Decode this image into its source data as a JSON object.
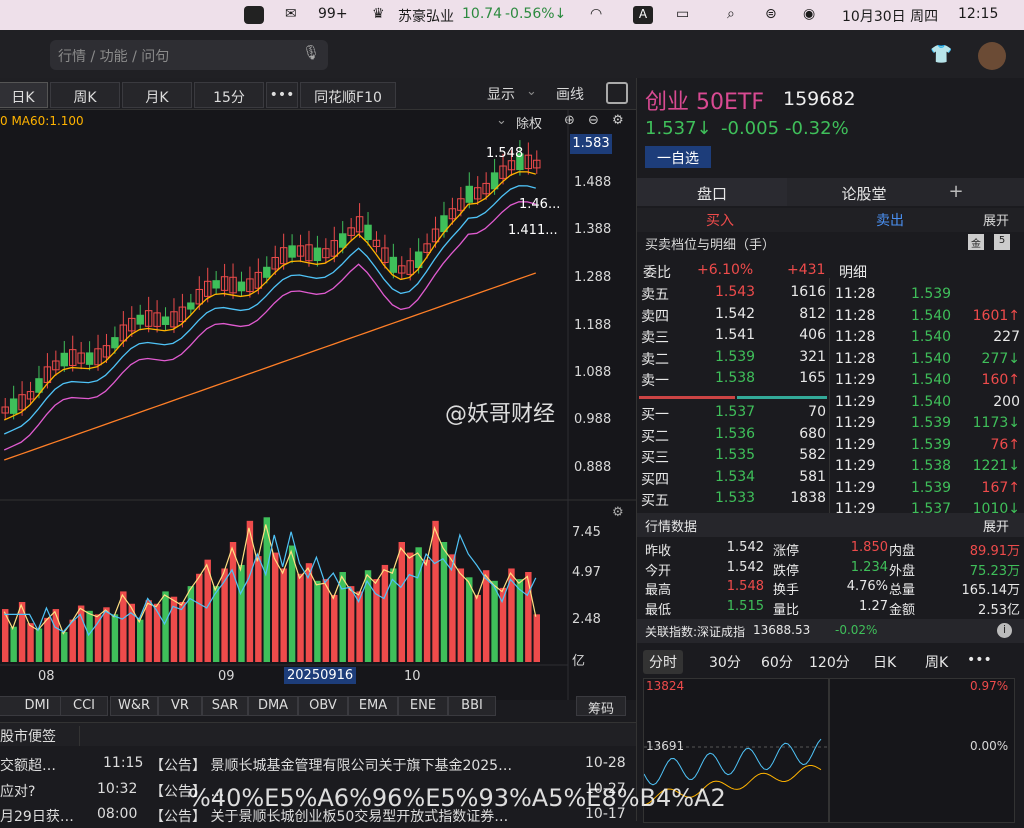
{
  "menubar": {
    "items": [
      "99+",
      "苏豪弘业",
      "10.74",
      "-0.56%↓",
      "10月30日 周四",
      "12:15"
    ]
  },
  "search": {
    "placeholder": "行情 / 功能 / 问句"
  },
  "tabs": [
    "日K",
    "周K",
    "月K",
    "15分",
    "•••",
    "同花顺F10"
  ],
  "toolbar": {
    "display": "显示",
    "draw": "画线",
    "ma_label": "0  MA60:1.100",
    "chuquan": "除权"
  },
  "chart_data": {
    "type": "candlestick",
    "price_axis": [
      "1.583",
      "1.488",
      "1.388",
      "1.288",
      "1.188",
      "1.088",
      "0.988",
      "0.888"
    ],
    "annotations": [
      "1.548",
      "1.46...",
      "1.411..."
    ],
    "volume_axis": [
      "7.45",
      "4.97",
      "2.48",
      "亿"
    ],
    "date_labels": [
      "08",
      "09",
      "20250916",
      "10"
    ],
    "volumes": [
      3.0,
      2.0,
      3.4,
      2.2,
      1.9,
      2.5,
      3.0,
      1.7,
      2.4,
      3.2,
      2.9,
      2.7,
      3.1,
      2.7,
      4.0,
      3.3,
      2.4,
      3.5,
      3.3,
      4.0,
      3.7,
      3.4,
      4.3,
      5.0,
      5.8,
      4.3,
      5.3,
      6.8,
      5.5,
      8.0,
      6.0,
      8.2,
      6.2,
      5.3,
      6.6,
      5.0,
      5.6,
      4.6,
      4.7,
      3.8,
      5.1,
      4.3,
      4.0,
      5.2,
      4.7,
      5.5,
      5.3,
      6.8,
      6.2,
      6.5,
      5.8,
      8.0,
      6.8,
      6.1,
      5.3,
      4.8,
      3.8,
      5.2,
      4.6,
      4.2,
      5.3,
      4.7,
      5.1,
      2.7
    ]
  },
  "indicators": [
    "DMI",
    "CCI",
    "W&R",
    "VR",
    "SAR",
    "DMA",
    "OBV",
    "EMA",
    "ENE",
    "BBI",
    "筹码"
  ],
  "news": {
    "tab": "股市便签",
    "rows": [
      {
        "a": "交额超…",
        "t": "11:15",
        "b": "【公告】 景顺长城基金管理有限公司关于旗下基金2025…",
        "d": "10-28"
      },
      {
        "a": "应对?",
        "t": "10:32",
        "b": "【公告】 …",
        "d": "10-27"
      },
      {
        "a": "月29日获…",
        "t": "08:00",
        "b": "【公告】 关于景顺长城创业板50交易型开放式指数证券…",
        "d": "10-17"
      }
    ]
  },
  "watermark": "@妖哥财经",
  "bottom_watermark": "%40%E5%A6%96%E5%93%A5%E8%B4%A2",
  "stock": {
    "name": "创业 50ETF",
    "code": "159682",
    "price": "1.537↓",
    "change": "-0.005",
    "pct": "-0.32%",
    "add_watch": "一自选"
  },
  "panel_tabs": {
    "pankou": "盘口",
    "lungutang": "论股堂",
    "plus": "+"
  },
  "trade_tabs": {
    "buy": "买入",
    "sell": "卖出",
    "expand": "展开"
  },
  "order_title": "买卖档位与明细（手）",
  "order_btns": [
    "金",
    "5"
  ],
  "weibi": {
    "label": "委比",
    "pct": "+6.10%",
    "num": "+431"
  },
  "detail_title": "明细",
  "asks": [
    {
      "l": "卖五",
      "p": "1.543",
      "v": "1616"
    },
    {
      "l": "卖四",
      "p": "1.542",
      "v": "812"
    },
    {
      "l": "卖三",
      "p": "1.541",
      "v": "406"
    },
    {
      "l": "卖二",
      "p": "1.539",
      "v": "321"
    },
    {
      "l": "卖一",
      "p": "1.538",
      "v": "165"
    }
  ],
  "bids": [
    {
      "l": "买一",
      "p": "1.537",
      "v": "70"
    },
    {
      "l": "买二",
      "p": "1.536",
      "v": "680"
    },
    {
      "l": "买三",
      "p": "1.535",
      "v": "582"
    },
    {
      "l": "买四",
      "p": "1.534",
      "v": "581"
    },
    {
      "l": "买五",
      "p": "1.533",
      "v": "1838"
    }
  ],
  "trades": [
    {
      "t": "11:28",
      "p": "1.539",
      "v": ""
    },
    {
      "t": "11:28",
      "p": "1.540",
      "v": "1601↑"
    },
    {
      "t": "11:28",
      "p": "1.540",
      "v": "227"
    },
    {
      "t": "11:28",
      "p": "1.540",
      "v": "277↓"
    },
    {
      "t": "11:29",
      "p": "1.540",
      "v": "160↑"
    },
    {
      "t": "11:29",
      "p": "1.540",
      "v": "200"
    },
    {
      "t": "11:29",
      "p": "1.539",
      "v": "1173↓"
    },
    {
      "t": "11:29",
      "p": "1.539",
      "v": "76↑"
    },
    {
      "t": "11:29",
      "p": "1.538",
      "v": "1221↓"
    },
    {
      "t": "11:29",
      "p": "1.539",
      "v": "167↑"
    },
    {
      "t": "11:29",
      "p": "1.537",
      "v": "1010↓"
    }
  ],
  "market": {
    "title": "行情数据",
    "expand": "展开",
    "rows": [
      [
        "昨收",
        "1.542",
        "涨停",
        "1.850",
        "内盘",
        "89.91万"
      ],
      [
        "今开",
        "1.542",
        "跌停",
        "1.234",
        "外盘",
        "75.23万"
      ],
      [
        "最高",
        "1.548",
        "换手",
        "4.76%",
        "总量",
        "165.14万"
      ],
      [
        "最低",
        "1.515",
        "量比",
        "1.27",
        "金额",
        "2.53亿"
      ]
    ]
  },
  "index": {
    "label": "关联指数:",
    "name": "深证成指",
    "value": "13688.53",
    "pct": "-0.02%"
  },
  "time_tabs": [
    "分时",
    "30分",
    "60分",
    "120分",
    "日K",
    "周K",
    "•••"
  ],
  "mini": {
    "top": "13824",
    "top_pct": "0.97%",
    "mid": "13691",
    "mid_pct": "0.00%"
  },
  "colors": {
    "up": "#ee4b4b",
    "down": "#3fbf5a",
    "accent": "#d94a92",
    "bg": "#16161a"
  }
}
